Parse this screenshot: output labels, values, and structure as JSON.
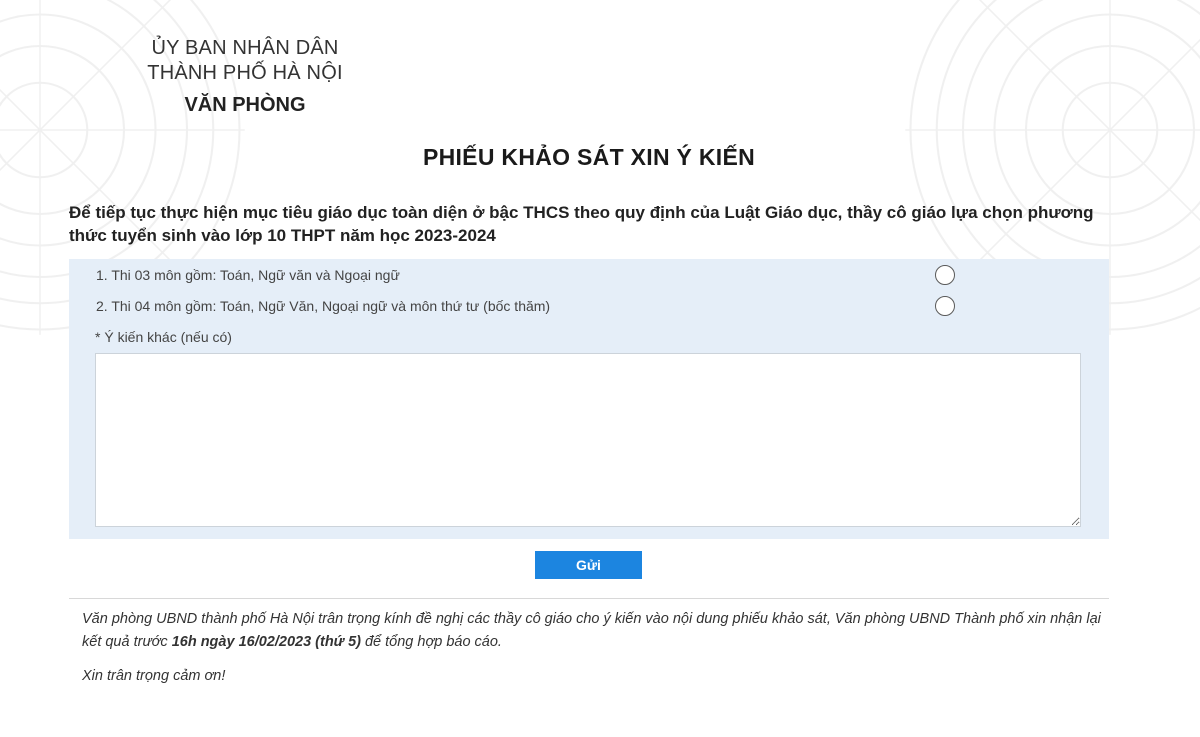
{
  "header": {
    "line1": "ỦY BAN NHÂN DÂN",
    "line2": "THÀNH PHỐ HÀ NỘI",
    "line3": "VĂN PHÒNG"
  },
  "title": "PHIẾU KHẢO SÁT XIN Ý KIẾN",
  "question": "Để tiếp tục thực hiện mục tiêu giáo dục toàn diện ở bậc THCS theo quy định của Luật Giáo dục, thầy cô giáo lựa chọn phương thức tuyển sinh vào lớp 10 THPT năm học 2023-2024",
  "options": [
    {
      "label": "1. Thi 03 môn gồm: Toán, Ngữ văn và Ngoại ngữ",
      "selected": false
    },
    {
      "label": "2. Thi 04 môn gồm: Toán, Ngữ Văn, Ngoại ngữ và môn thứ tư (bốc thăm)",
      "selected": false
    }
  ],
  "other_label": "* Ý kiến khác (nếu có)",
  "other_value": "",
  "submit_label": "Gửi",
  "note": {
    "part1": "Văn phòng UBND thành phố Hà Nội trân trọng kính đề nghị các thầy cô giáo cho ý kiến vào nội dung phiếu khảo sát, Văn phòng UBND Thành phố xin nhận lại kết quả trước ",
    "deadline": "16h ngày 16/02/2023 (thứ 5)",
    "part2": " để tổng hợp báo cáo."
  },
  "thanks": "Xin trân trọng cảm ơn!",
  "colors": {
    "panel_bg": "#e5eef8",
    "button_bg": "#1c85e0",
    "button_text": "#ffffff"
  }
}
